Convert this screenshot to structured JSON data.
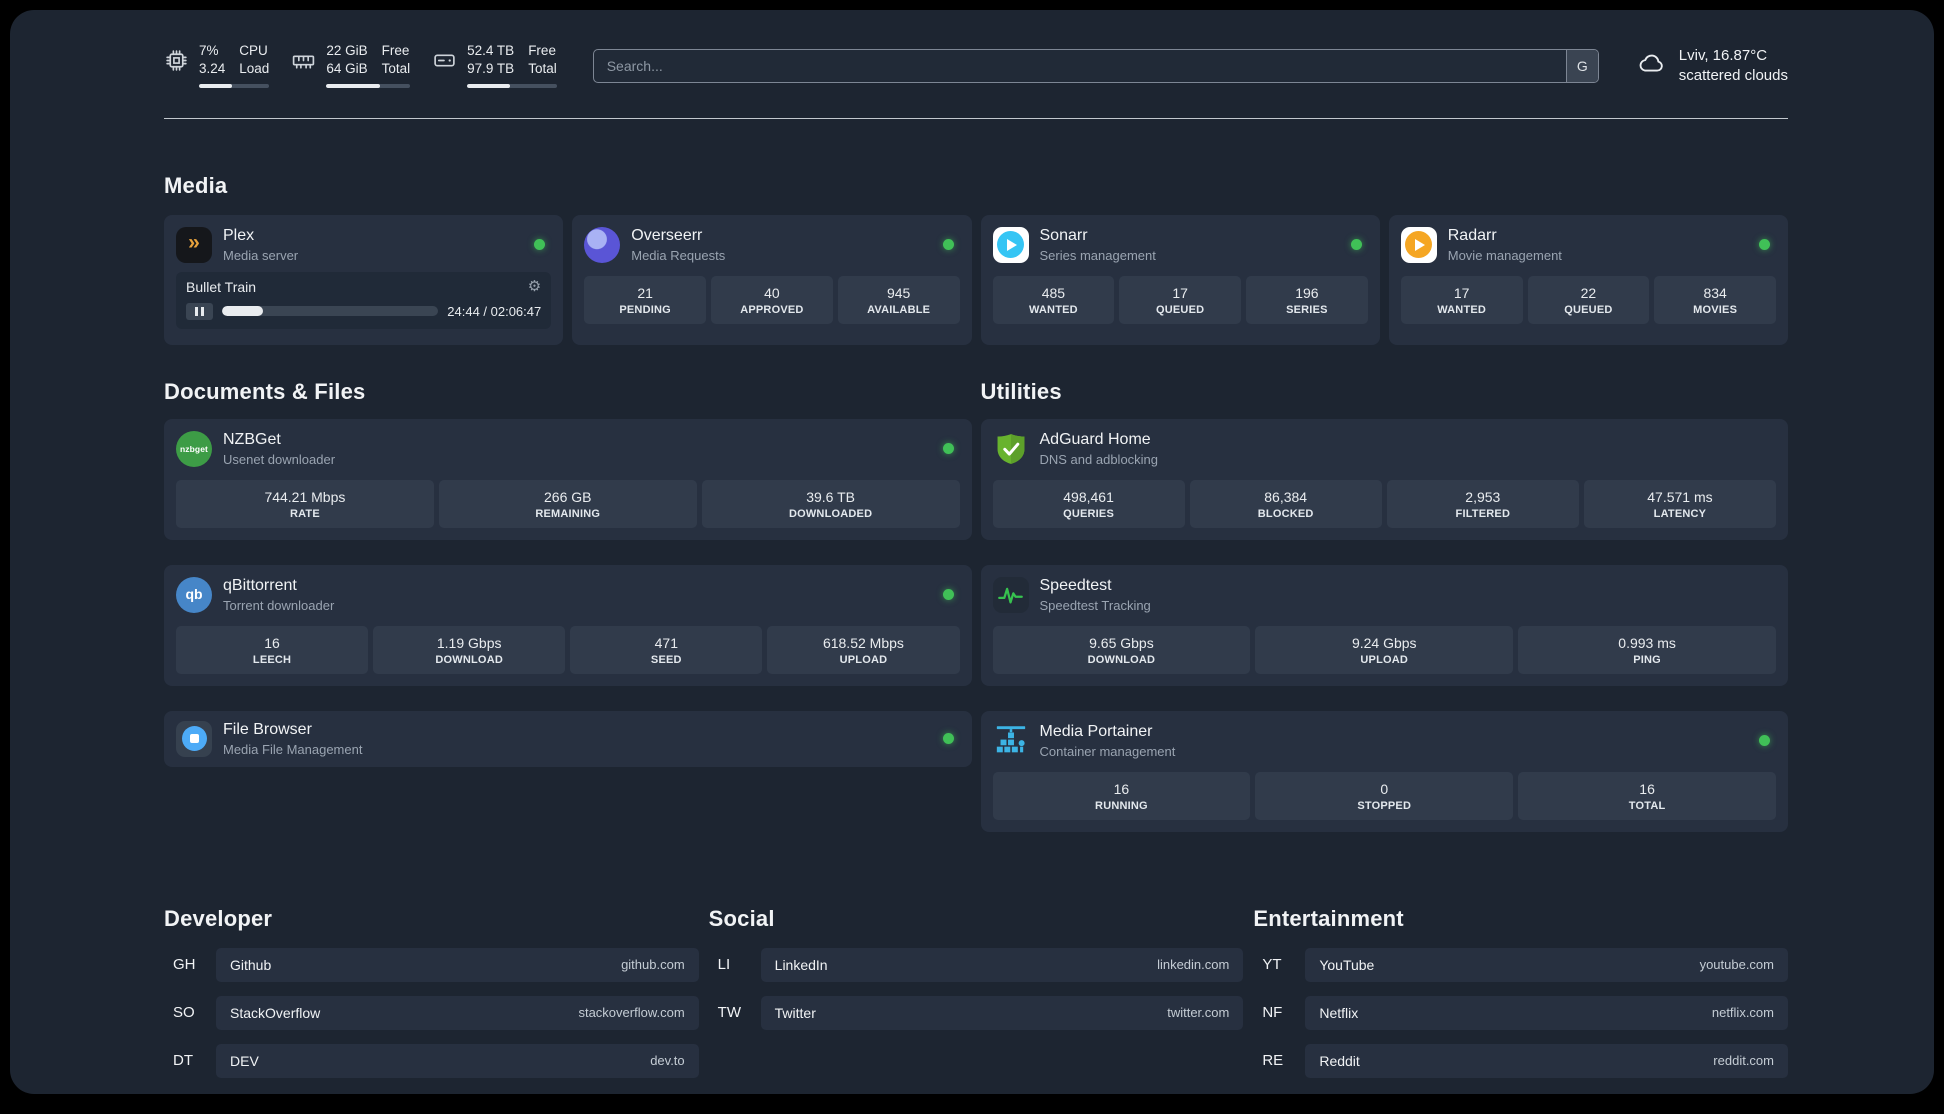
{
  "topbar": {
    "cpu": {
      "line1": "7%",
      "line2": "3.24",
      "label1": "CPU",
      "label2": "Load",
      "progress": 47
    },
    "ram": {
      "line1": "22 GiB",
      "line2": "64 GiB",
      "label1": "Free",
      "label2": "Total",
      "progress": 64
    },
    "disk": {
      "line1": "52.4 TB",
      "line2": "97.9 TB",
      "label1": "Free",
      "label2": "Total",
      "progress": 48
    },
    "search": {
      "placeholder": "Search...",
      "button_label": "G"
    },
    "weather": {
      "location": "Lviv, 16.87°C",
      "condition": "scattered clouds"
    }
  },
  "media": {
    "heading": "Media",
    "plex": {
      "name": "Plex",
      "desc": "Media server",
      "now_playing": "Bullet Train",
      "time": "24:44 / 02:06:47",
      "progress_pct": 19
    },
    "overseerr": {
      "name": "Overseerr",
      "desc": "Media Requests",
      "stats": [
        {
          "value": "21",
          "label": "PENDING"
        },
        {
          "value": "40",
          "label": "APPROVED"
        },
        {
          "value": "945",
          "label": "AVAILABLE"
        }
      ]
    },
    "sonarr": {
      "name": "Sonarr",
      "desc": "Series management",
      "stats": [
        {
          "value": "485",
          "label": "WANTED"
        },
        {
          "value": "17",
          "label": "QUEUED"
        },
        {
          "value": "196",
          "label": "SERIES"
        }
      ]
    },
    "radarr": {
      "name": "Radarr",
      "desc": "Movie management",
      "stats": [
        {
          "value": "17",
          "label": "WANTED"
        },
        {
          "value": "22",
          "label": "QUEUED"
        },
        {
          "value": "834",
          "label": "MOVIES"
        }
      ]
    }
  },
  "documents": {
    "heading": "Documents & Files",
    "nzbget": {
      "name": "NZBGet",
      "desc": "Usenet downloader",
      "icon_label": "nzbget",
      "stats": [
        {
          "value": "744.21 Mbps",
          "label": "RATE"
        },
        {
          "value": "266 GB",
          "label": "REMAINING"
        },
        {
          "value": "39.6 TB",
          "label": "DOWNLOADED"
        }
      ]
    },
    "qbittorrent": {
      "name": "qBittorrent",
      "desc": "Torrent downloader",
      "icon_label": "qb",
      "stats": [
        {
          "value": "16",
          "label": "LEECH"
        },
        {
          "value": "1.19 Gbps",
          "label": "DOWNLOAD"
        },
        {
          "value": "471",
          "label": "SEED"
        },
        {
          "value": "618.52 Mbps",
          "label": "UPLOAD"
        }
      ]
    },
    "filebrowser": {
      "name": "File Browser",
      "desc": "Media File Management"
    }
  },
  "utilities": {
    "heading": "Utilities",
    "adguard": {
      "name": "AdGuard Home",
      "desc": "DNS and adblocking",
      "stats": [
        {
          "value": "498,461",
          "label": "QUERIES"
        },
        {
          "value": "86,384",
          "label": "BLOCKED"
        },
        {
          "value": "2,953",
          "label": "FILTERED"
        },
        {
          "value": "47.571 ms",
          "label": "LATENCY"
        }
      ]
    },
    "speedtest": {
      "name": "Speedtest",
      "desc": "Speedtest Tracking",
      "stats": [
        {
          "value": "9.65 Gbps",
          "label": "DOWNLOAD"
        },
        {
          "value": "9.24 Gbps",
          "label": "UPLOAD"
        },
        {
          "value": "0.993 ms",
          "label": "PING"
        }
      ]
    },
    "portainer": {
      "name": "Media Portainer",
      "desc": "Container management",
      "stats": [
        {
          "value": "16",
          "label": "RUNNING"
        },
        {
          "value": "0",
          "label": "STOPPED"
        },
        {
          "value": "16",
          "label": "TOTAL"
        }
      ]
    }
  },
  "bookmarks": {
    "developer": {
      "heading": "Developer",
      "items": [
        {
          "abbr": "GH",
          "name": "Github",
          "url": "github.com"
        },
        {
          "abbr": "SO",
          "name": "StackOverflow",
          "url": "stackoverflow.com"
        },
        {
          "abbr": "DT",
          "name": "DEV",
          "url": "dev.to"
        }
      ]
    },
    "social": {
      "heading": "Social",
      "items": [
        {
          "abbr": "LI",
          "name": "LinkedIn",
          "url": "linkedin.com"
        },
        {
          "abbr": "TW",
          "name": "Twitter",
          "url": "twitter.com"
        }
      ]
    },
    "entertainment": {
      "heading": "Entertainment",
      "items": [
        {
          "abbr": "YT",
          "name": "YouTube",
          "url": "youtube.com"
        },
        {
          "abbr": "NF",
          "name": "Netflix",
          "url": "netflix.com"
        },
        {
          "abbr": "RE",
          "name": "Reddit",
          "url": "reddit.com"
        }
      ]
    }
  },
  "colors": {
    "status_online": "#40c057",
    "background": "#1d2531",
    "card": "#273040",
    "tile": "#313b4b",
    "plex_accent": "#e8a33d",
    "adguard_green": "#68b32e",
    "portainer_blue": "#3cb4e5"
  }
}
